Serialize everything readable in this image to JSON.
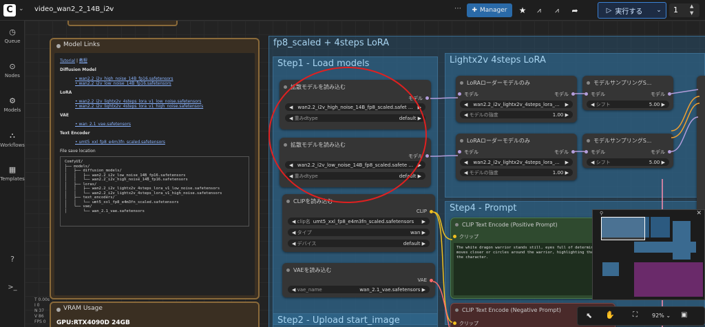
{
  "topbar": {
    "logo": "C",
    "workflow_name": "video_wan2_2_14B_i2v",
    "manager": "Manager",
    "run": "実行する",
    "queue_count": "1"
  },
  "sidebar": {
    "items": [
      {
        "icon": "◷",
        "label": "Queue"
      },
      {
        "icon": "⊙",
        "label": "Nodes"
      },
      {
        "icon": "⚙",
        "label": "Models"
      },
      {
        "icon": "⛬",
        "label": "Workflows"
      },
      {
        "icon": "▦",
        "label": "Templates"
      }
    ],
    "help": "?",
    "console": ">_"
  },
  "stats": [
    "T 0.00s",
    "I 0",
    "N 37",
    "V 86",
    "FPS 0"
  ],
  "model_links": {
    "title": "Model Links",
    "tutorial": "Tutorial",
    "manual": "教程",
    "sep": " | ",
    "diffusion_heading": "Diffusion Model",
    "diffusion": [
      "wan2.2_i2v_high_noise_14B_fp16.safetensors",
      "wan2.2_i2v_low_noise_14B_fp16.safetensors"
    ],
    "lora_heading": "LoRA",
    "lora": [
      "wan2.2_i2v_lightx2v_4steps_lora_v1_low_noise.safetensors",
      "wan2.2_i2v_lightx2v_4steps_lora_v1_high_noise.safetensors"
    ],
    "vae_heading": "VAE",
    "vae": [
      "wan_2.1_vae.safetensors"
    ],
    "te_heading": "Text Encoder",
    "te": [
      "umt5_xxl_fp8_e4m3fn_scaled.safetensors"
    ],
    "save_heading": "File save location",
    "tree": [
      "ComfyUI/",
      "├── models/",
      "│   ├── diffusion_models/",
      "│   │   ├── wan2.2_i2v_low_noise_14B_fp16.safetensors",
      "│   │   └── wan2.2_i2v_high_noise_14B_fp16.safetensors",
      "│   ├── loras/",
      "│   │   ├── wan2.2_i2v_lightx2v_4steps_lora_v1_low_noise.safetensors",
      "│   │   └── wan2.2_i2v_lightx2v_4steps_lora_v1_high_noise.safetensors",
      "│   ├── text_encoders/",
      "│   │   └── umt5_xxl_fp8_e4m3fn_scaled.safetensors",
      "│   └── vae/",
      "│       └── wan_2.1_vae.safetensors"
    ]
  },
  "vram": {
    "title": "VRAM Usage",
    "gpu": "GPU:RTX4090D 24GB"
  },
  "groups": {
    "main": "fp8_scaled + 4steps LoRA",
    "step1": "Step1 - Load models",
    "lightx": "Lightx2v 4steps LoRA",
    "step4": "Step4 - Prompt",
    "step2": "Step2 - Upload start_image"
  },
  "nodes": {
    "unet1": {
      "title": "拡散モデルを読み込む",
      "out": "モデル",
      "model": "wan2.2_i2v_high_noise_14B_fp8_scaled.safet ...",
      "dtype_label": "重みdtype",
      "dtype": "default"
    },
    "unet2": {
      "title": "拡散モデルを読み込む",
      "out": "モデル",
      "model": "wan2.2_i2v_low_noise_14B_fp8_scaled.safete ...",
      "dtype_label": "重みdtype",
      "dtype": "default"
    },
    "lora1": {
      "title": "LoRAローダーモデルのみ",
      "in": "モデル",
      "out": "モデル",
      "lora": "wan2.2_i2v_lightx2v_4steps_lora_...",
      "strength_label": "モデルの強度",
      "strength": "1.00"
    },
    "lora2": {
      "title": "LoRAローダーモデルのみ",
      "in": "モデル",
      "out": "モデル",
      "lora": "wan2.2_i2v_lightx2v_4steps_lora_...",
      "strength_label": "モデルの強度",
      "strength": "1.00"
    },
    "samp1": {
      "title": "モデルサンプリングS...",
      "in": "モデル",
      "out": "モデル",
      "shift_label": "シフト",
      "shift": "5.00"
    },
    "samp2": {
      "title": "モデルサンプリングS...",
      "in": "モデル",
      "out": "モデル",
      "shift_label": "シフト",
      "shift": "5.00"
    },
    "clip": {
      "title": "CLIPを読み込む",
      "out": "CLIP",
      "name_label": "clip名",
      "name": "umt5_xxl_fp8_e4m3fn_scaled.safetensors",
      "type_label": "タイプ",
      "type": "wan",
      "device_label": "デバイス",
      "device": "default"
    },
    "vae": {
      "title": "VAEを読み込む",
      "out": "VAE",
      "name_label": "vae_name",
      "name": "wan_2.1_vae.safetensors"
    },
    "pos": {
      "title": "CLIP Text Encode (Positive Prompt)",
      "in": "クリップ",
      "text": "The white dragon warrior stands still, eyes full of determinat moves closer or circles around the warrior, highlighting the p of the character."
    },
    "neg": {
      "title": "CLIP Text Encode (Negative Prompt)",
      "in": "クリップ"
    }
  },
  "bottombar": {
    "zoom": "92%"
  }
}
